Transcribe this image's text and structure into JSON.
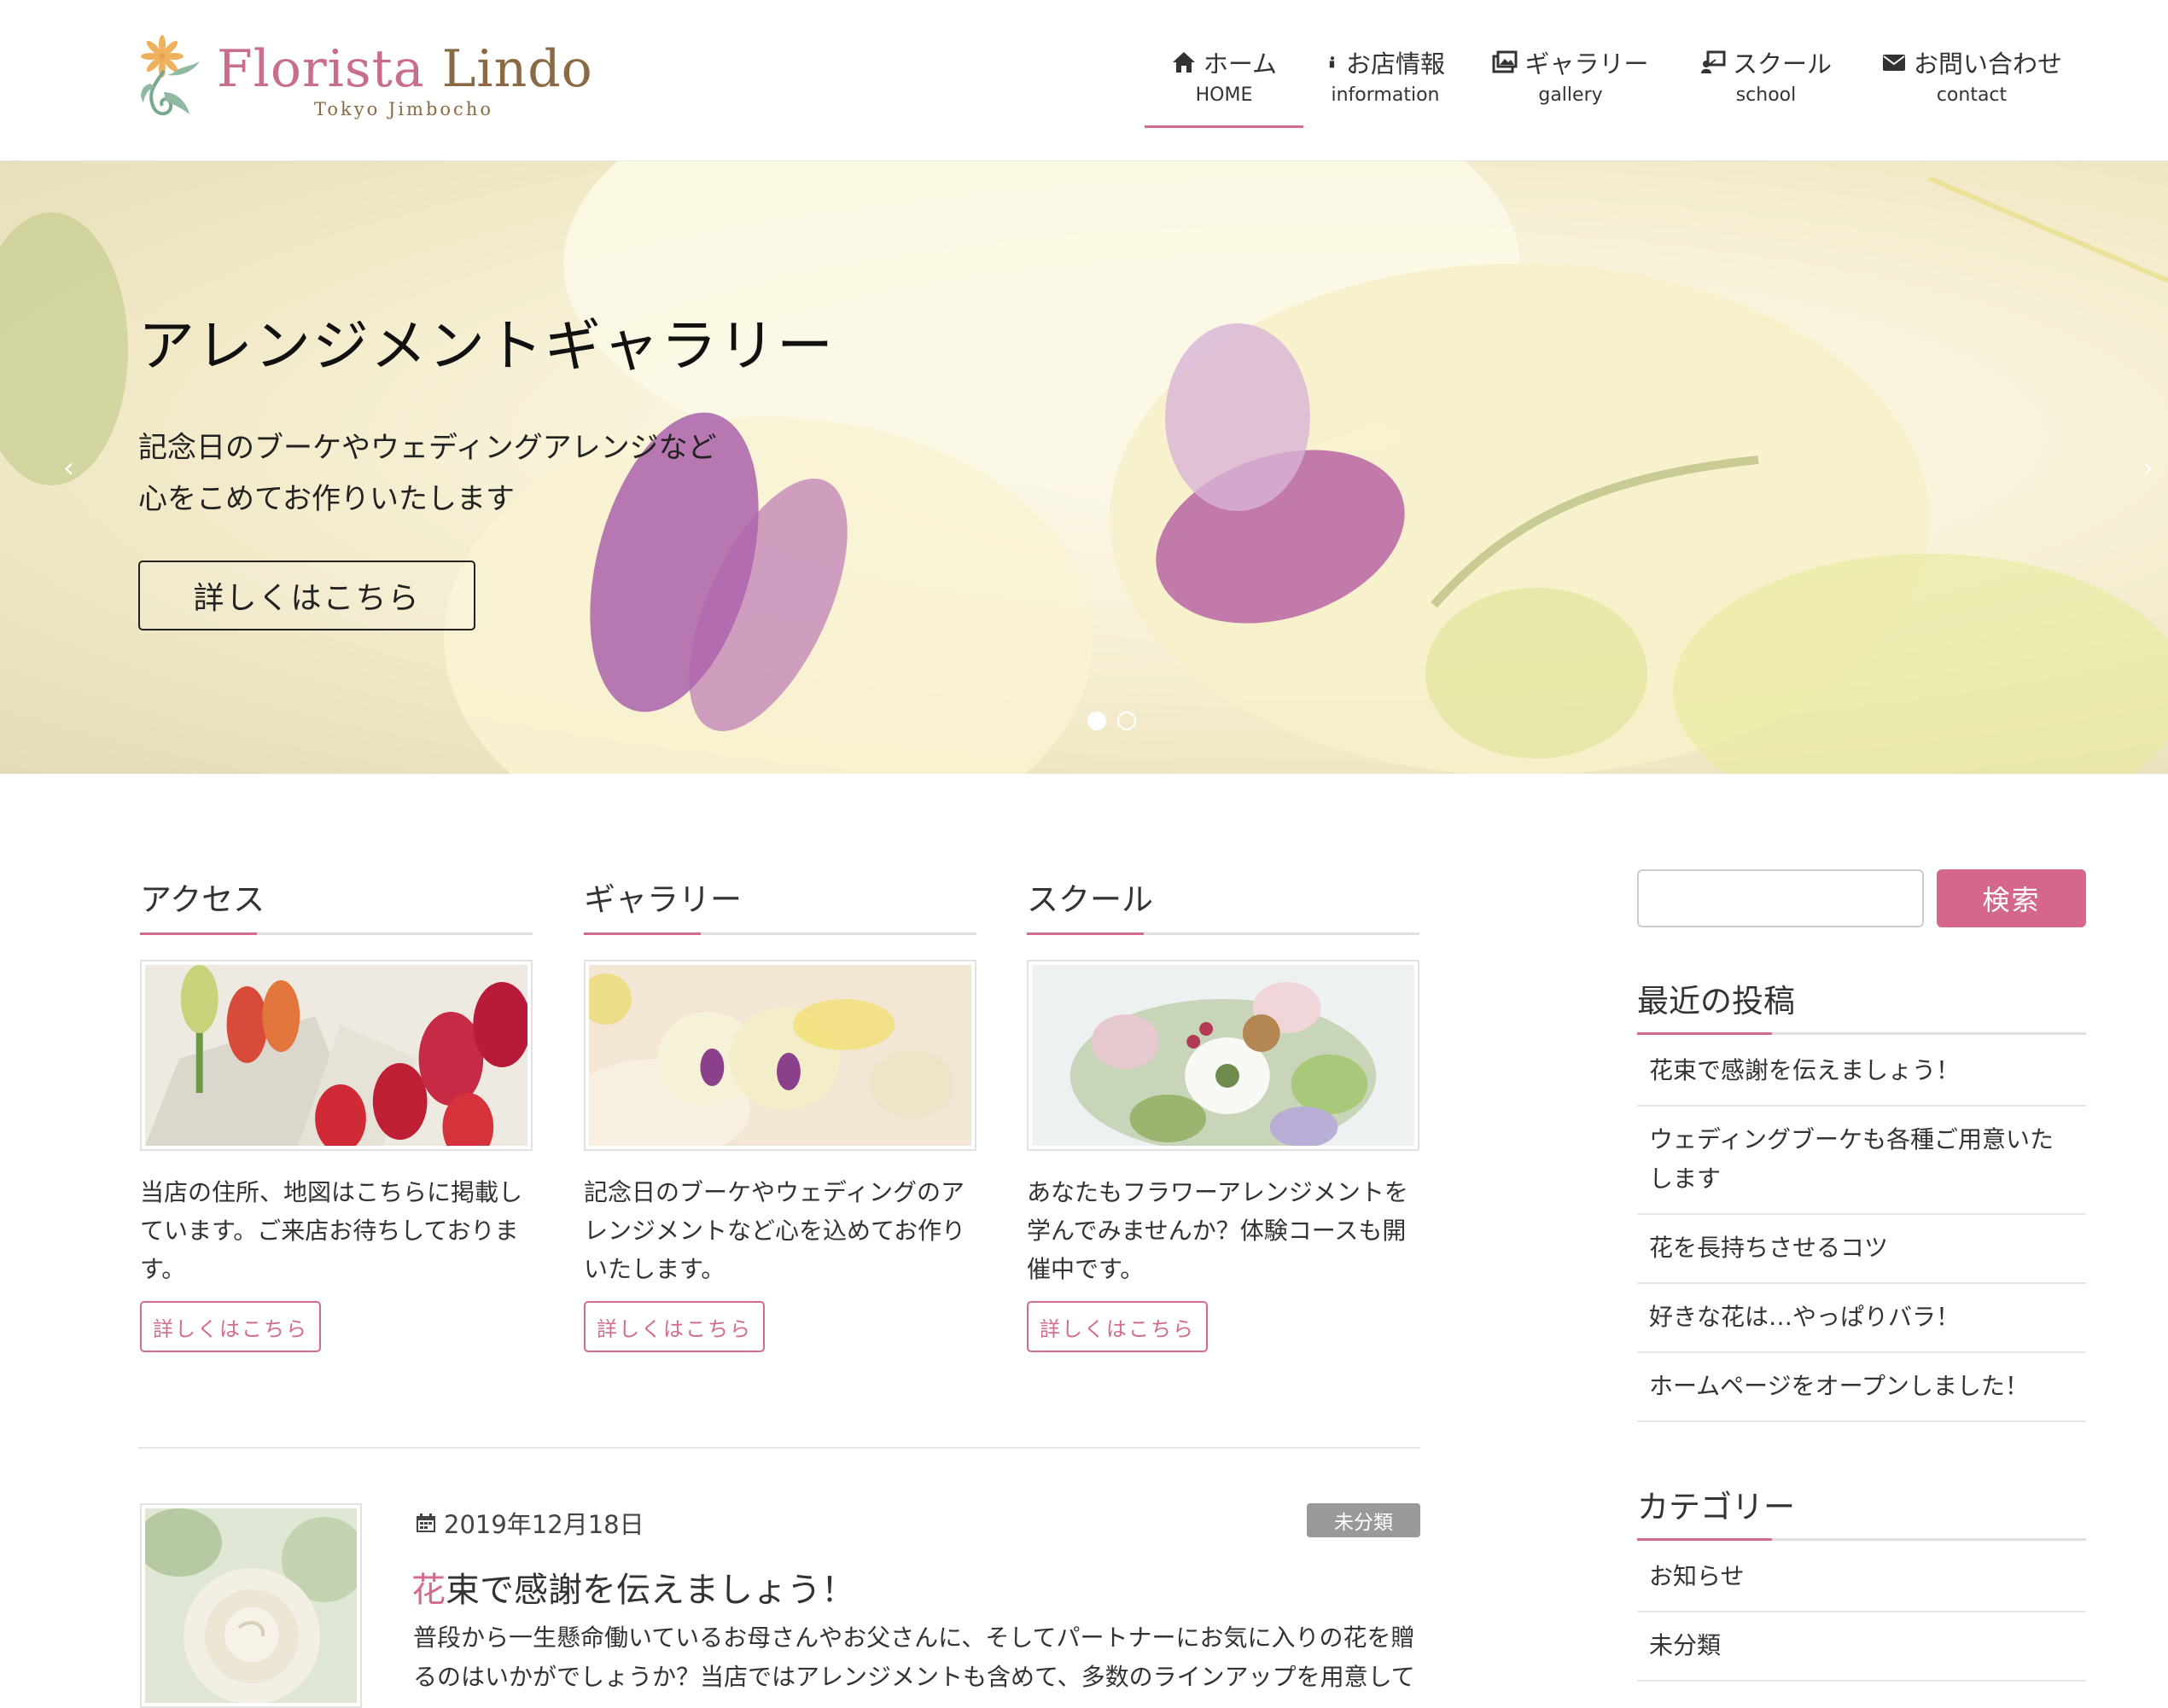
{
  "brand": {
    "name_part1": "Florista",
    "name_part2": "Lindo",
    "subtitle": "Tokyo Jimbocho",
    "pink": "#d36b8c",
    "brown": "#8a6a45"
  },
  "nav": [
    {
      "jp": "ホーム",
      "en": "HOME",
      "icon": "home-icon"
    },
    {
      "jp": "お店情報",
      "en": "information",
      "icon": "info-icon"
    },
    {
      "jp": "ギャラリー",
      "en": "gallery",
      "icon": "images-icon"
    },
    {
      "jp": "スクール",
      "en": "school",
      "icon": "school-icon"
    },
    {
      "jp": "お問い合わせ",
      "en": "contact",
      "icon": "envelope-icon"
    }
  ],
  "hero": {
    "title": "アレンジメントギャラリー",
    "line1": "記念日のブーケやウェディングアレンジなど",
    "line2": "心をこめてお作りいたします",
    "button": "詳しくはこちら",
    "prev": "‹",
    "next": "›",
    "slides": 2,
    "active_slide": 1
  },
  "features": [
    {
      "title": "アクセス",
      "text": "当店の住所、地図はこちらに掲載しています。ご来店お待ちしております。",
      "button": "詳しくはこちら"
    },
    {
      "title": "ギャラリー",
      "text": "記念日のブーケやウェディングのアレンジメントなど心を込めてお作りいたします。",
      "button": "詳しくはこちら"
    },
    {
      "title": "スクール",
      "text": "あなたもフラワーアレンジメントを学んでみませんか？体験コースも開催中です。",
      "button": "詳しくはこちら"
    }
  ],
  "post": {
    "date": "2019年12月18日",
    "category": "未分類",
    "title_first": "花",
    "title_rest": "束で感謝を伝えましょう！",
    "excerpt": "普段から一生懸命働いているお母さんやお父さんに、そしてパートナーにお気に入りの花を贈るのはいかがでしょうか？当店ではアレンジメントも含めて、多数のラインアップを用意して"
  },
  "sidebar": {
    "search_input_value": "",
    "search_button": "検索",
    "recent_title": "最近の投稿",
    "recent": [
      "花束で感謝を伝えましょう！",
      "ウェディングブーケも各種ご用意いたします",
      "花を長持ちさせるコツ",
      "好きな花は…やっぱりバラ！",
      "ホームページをオープンしました！"
    ],
    "category_title": "カテゴリー",
    "categories": [
      "お知らせ",
      "未分類"
    ]
  }
}
